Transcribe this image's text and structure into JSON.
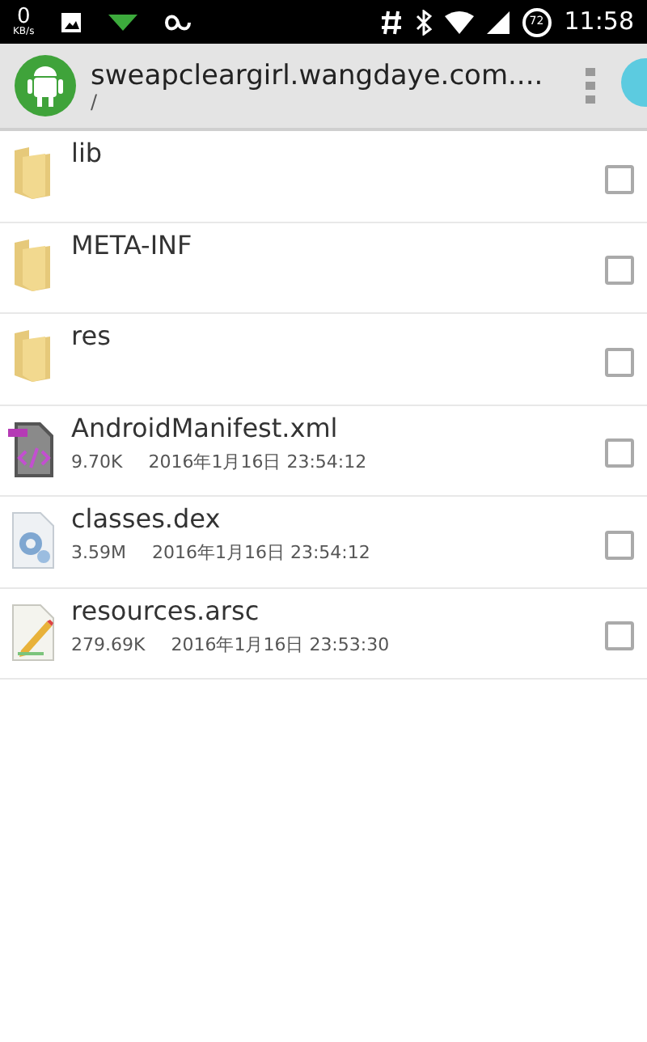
{
  "status_bar": {
    "speed_value": "0",
    "speed_unit": "KB/s",
    "battery": "72",
    "time": "11:58"
  },
  "header": {
    "title": "sweapcleargirl.wangdaye.com....",
    "path": "/"
  },
  "files": [
    {
      "kind": "folder",
      "name": "lib",
      "checked": false
    },
    {
      "kind": "folder",
      "name": "META-INF",
      "checked": false
    },
    {
      "kind": "folder",
      "name": "res",
      "checked": false
    },
    {
      "kind": "xml",
      "name": "AndroidManifest.xml",
      "size": "9.70K",
      "date": "2016年1月16日 23:54:12",
      "checked": false
    },
    {
      "kind": "dex",
      "name": "classes.dex",
      "size": "3.59M",
      "date": "2016年1月16日 23:54:12",
      "checked": false
    },
    {
      "kind": "arsc",
      "name": "resources.arsc",
      "size": "279.69K",
      "date": "2016年1月16日 23:53:30",
      "checked": false
    }
  ]
}
